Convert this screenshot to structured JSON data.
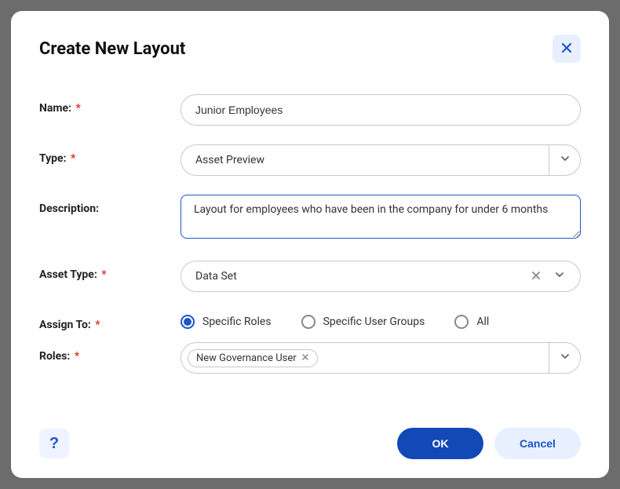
{
  "modal": {
    "title": "Create New Layout"
  },
  "fields": {
    "name": {
      "label": "Name:",
      "value": "Junior Employees"
    },
    "type": {
      "label": "Type:",
      "value": "Asset Preview"
    },
    "description": {
      "label": "Description:",
      "value": "Layout for employees who have been in the company for under 6 months"
    },
    "assetType": {
      "label": "Asset Type:",
      "value": "Data Set"
    },
    "assignTo": {
      "label": "Assign To:",
      "options": {
        "specificRoles": "Specific Roles",
        "specificUserGroups": "Specific User Groups",
        "all": "All"
      },
      "selected": "specificRoles"
    },
    "roles": {
      "label": "Roles:",
      "chips": [
        {
          "label": "New Governance User"
        }
      ]
    }
  },
  "footer": {
    "help": "?",
    "ok": "OK",
    "cancel": "Cancel"
  }
}
